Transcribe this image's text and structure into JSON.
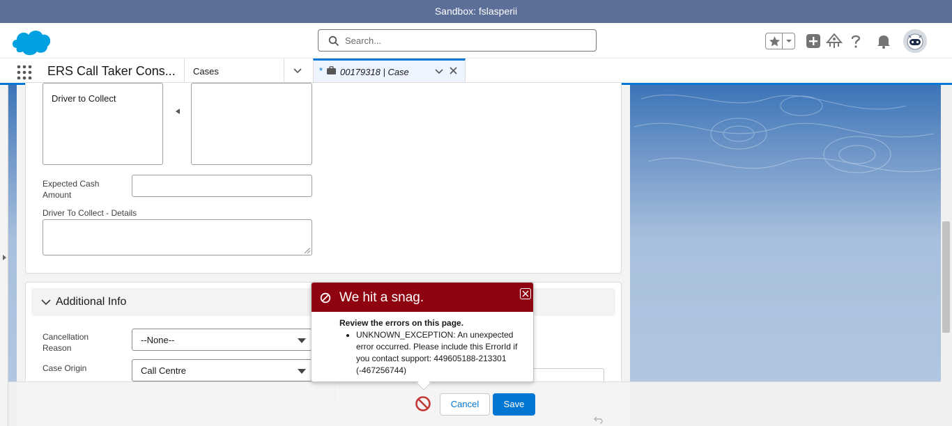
{
  "sandbox": {
    "label": "Sandbox: fslasperii"
  },
  "header": {
    "search_placeholder": "Search..."
  },
  "nav": {
    "app_name": "ERS Call Taker Cons...",
    "cases_label": "Cases",
    "tab": {
      "dirty_marker": "*",
      "label": "00179318 | Case"
    }
  },
  "form": {
    "listbox_left_option": "Driver to Collect",
    "expected_cash_label_1": "Expected Cash",
    "expected_cash_label_2": "Amount",
    "driver_details_label": "Driver To Collect - Details",
    "section_title": "Additional Info",
    "cancellation_label_1": "Cancellation",
    "cancellation_label_2": "Reason",
    "cancellation_value": "--None--",
    "case_origin_label": "Case Origin",
    "case_origin_value": "Call Centre"
  },
  "error_popover": {
    "title": "We hit a snag.",
    "body_heading": "Review the errors on this page.",
    "message": "UNKNOWN_EXCEPTION: An unexpected error occurred. Please include this ErrorId if you contact support: 449605188-213301 (-467256744)"
  },
  "footer": {
    "cancel_label": "Cancel",
    "save_label": "Save"
  },
  "colors": {
    "brand": "#0176d3",
    "error": "#8e030f",
    "sandbox_bar": "#5c6f99"
  }
}
